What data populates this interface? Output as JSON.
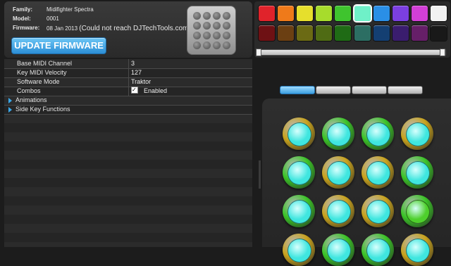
{
  "device_info": {
    "family_label": "Family:",
    "family_value": "Midifighter Spectra",
    "model_label": "Model:",
    "model_value": "0001",
    "firmware_label": "Firmware:",
    "firmware_date": "08 Jan 2013",
    "firmware_note": "(Could not reach DJTechTools.com)",
    "update_button": "UPDATE FIRMWARE"
  },
  "settings": [
    {
      "key": "Base MIDI Channel",
      "value": "3"
    },
    {
      "key": "Key MIDI Velocity",
      "value": "127"
    },
    {
      "key": "Software Mode",
      "value": "Traktor"
    },
    {
      "key": "Combos",
      "value": "Enabled",
      "checked": true
    }
  ],
  "sections": [
    {
      "label": "Animations"
    },
    {
      "label": "Side Key Functions"
    }
  ],
  "palette": {
    "top_row": [
      "#e0232b",
      "#ef7a1a",
      "#e6df2c",
      "#a7dc2c",
      "#3fc42e",
      "#6ff0c8",
      "#2a8fe6",
      "#7b3fe0",
      "#d23fd6",
      "#f2f2f2"
    ],
    "bottom_row": [
      "#6e1114",
      "#6b3f12",
      "#6b6a14",
      "#4f6b14",
      "#1f6b15",
      "#2c6e63",
      "#143f72",
      "#3a1d6e",
      "#661f68",
      "#191919"
    ],
    "selected_index": 5
  },
  "tabs": {
    "count": 4,
    "active_index": 0
  },
  "pads": {
    "rows": [
      [
        {
          "ring": "#c9a31d",
          "face": "#3fe6df"
        },
        {
          "ring": "#3bc427",
          "face": "#3fe6df"
        },
        {
          "ring": "#3bc427",
          "face": "#3fe6df"
        },
        {
          "ring": "#c9a31d",
          "face": "#3fe6df"
        }
      ],
      [
        {
          "ring": "#3bc427",
          "face": "#3fe6df"
        },
        {
          "ring": "#c9a31d",
          "face": "#3fe6df"
        },
        {
          "ring": "#c9a31d",
          "face": "#3fe6df"
        },
        {
          "ring": "#3bc427",
          "face": "#3fe6df"
        }
      ],
      [
        {
          "ring": "#3bc427",
          "face": "#3fe6df"
        },
        {
          "ring": "#c9a31d",
          "face": "#3fe6df"
        },
        {
          "ring": "#c9a31d",
          "face": "#3fe6df"
        },
        {
          "ring": "#3bc427",
          "face": "#4ed02c"
        }
      ],
      [
        {
          "ring": "#c9a31d",
          "face": "#3fe6df"
        },
        {
          "ring": "#3bc427",
          "face": "#3fe6df"
        },
        {
          "ring": "#3bc427",
          "face": "#3fe6df"
        },
        {
          "ring": "#c9a31d",
          "face": "#3fe6df"
        }
      ]
    ]
  }
}
